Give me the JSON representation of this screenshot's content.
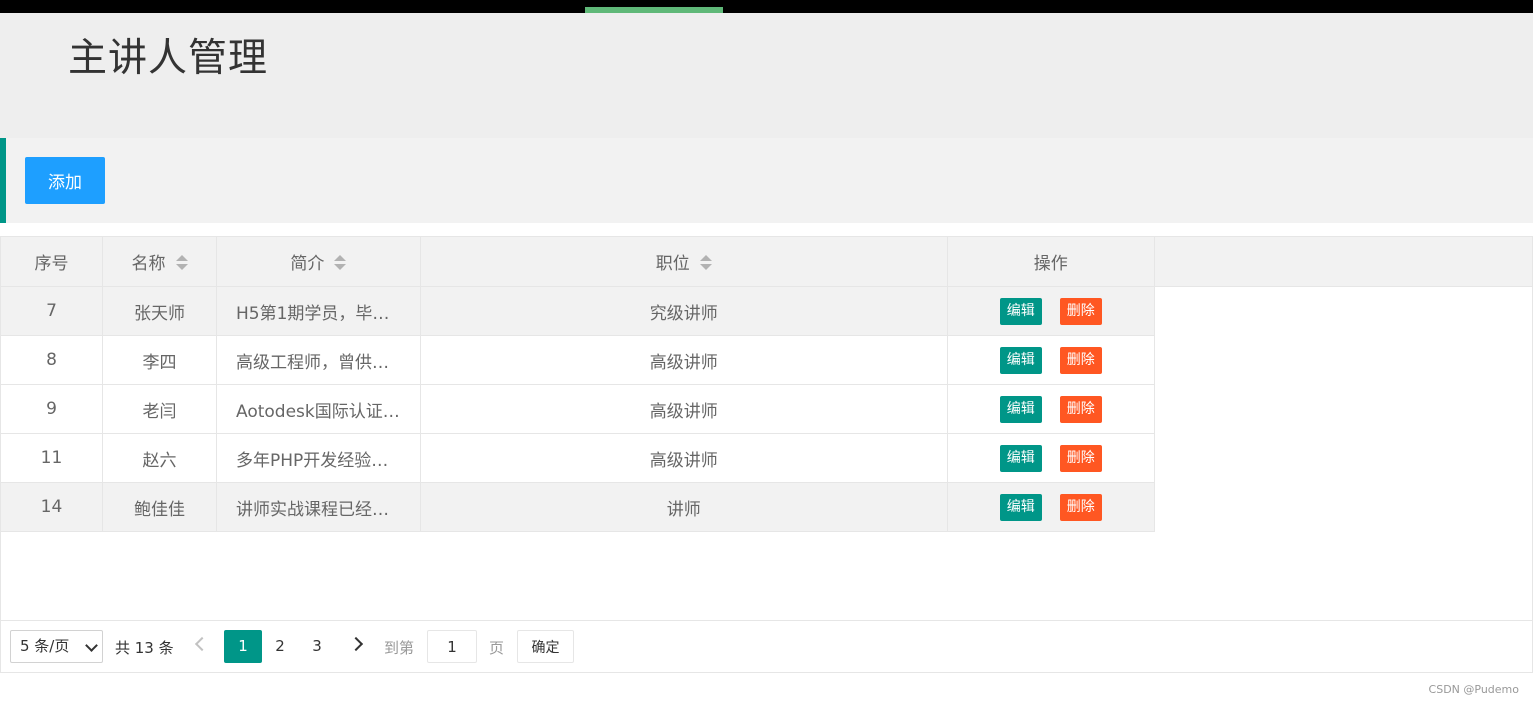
{
  "page": {
    "title": "主讲人管理"
  },
  "toolbar": {
    "add_label": "添加"
  },
  "table": {
    "columns": [
      {
        "label": "序号",
        "sortable": false
      },
      {
        "label": "名称",
        "sortable": true
      },
      {
        "label": "简介",
        "sortable": true
      },
      {
        "label": "职位",
        "sortable": true
      },
      {
        "label": "操作",
        "sortable": false
      }
    ],
    "rows": [
      {
        "id": "7",
        "name": "张天师",
        "intro": "H5第1期学员，毕…",
        "position": "究级讲师"
      },
      {
        "id": "8",
        "name": "李四",
        "intro": "高级工程师，曾供…",
        "position": "高级讲师"
      },
      {
        "id": "9",
        "name": "老闫",
        "intro": "Aotodesk国际认证…",
        "position": "高级讲师"
      },
      {
        "id": "11",
        "name": "赵六",
        "intro": "多年PHP开发经验…",
        "position": "高级讲师"
      },
      {
        "id": "14",
        "name": "鲍佳佳",
        "intro": "讲师实战课程已经…",
        "position": "讲师"
      }
    ],
    "edit_label": "编辑",
    "delete_label": "删除"
  },
  "pager": {
    "limit_selected": "5 条/页",
    "total_text": "共 13 条",
    "pages": [
      "1",
      "2",
      "3"
    ],
    "current_page": "1",
    "goto_label": "到第",
    "goto_value": "1",
    "page_unit": "页",
    "confirm_label": "确定"
  },
  "watermark": "CSDN @Pudemo",
  "colors": {
    "primary": "#009688",
    "add_button": "#1e9fff",
    "delete_button": "#ff5722",
    "top_accent": "#5fb878"
  },
  "icons": [
    "sort-icon",
    "chevron-down-icon",
    "chevron-left-icon",
    "chevron-right-icon"
  ]
}
